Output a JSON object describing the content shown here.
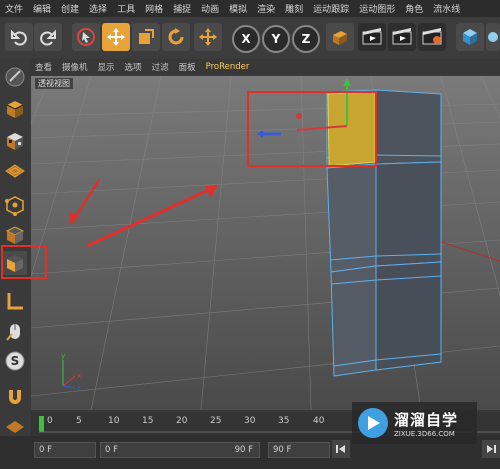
{
  "menu": [
    "文件",
    "编辑",
    "创建",
    "选择",
    "工具",
    "网格",
    "捕捉",
    "动画",
    "模拟",
    "渲染",
    "雕刻",
    "运动跟踪",
    "运动图形",
    "角色",
    "流水线"
  ],
  "toolbar": {
    "undo_icon": "undo-icon",
    "redo_icon": "redo-icon",
    "axis_x": "X",
    "axis_y": "Y",
    "axis_z": "Z"
  },
  "view_menu": [
    "查看",
    "摄像机",
    "显示",
    "选项",
    "过滤",
    "面板",
    "ProRender"
  ],
  "viewport": {
    "label": "透视视图"
  },
  "timeline": {
    "ticks": [
      "0",
      "5",
      "10",
      "15",
      "20",
      "25",
      "30",
      "35",
      "40"
    ]
  },
  "bottom": {
    "start_frame": "0 F",
    "current_frame": "0 F",
    "end_frame": "90 F",
    "end_frame2": "90 F"
  },
  "watermark": {
    "brand": "溜溜自学",
    "url": "ZIXUE.3D66.COM"
  },
  "colors": {
    "accent": "#e7a33a",
    "highlight_box": "#e0302a",
    "selected_face": "#c8a530"
  }
}
